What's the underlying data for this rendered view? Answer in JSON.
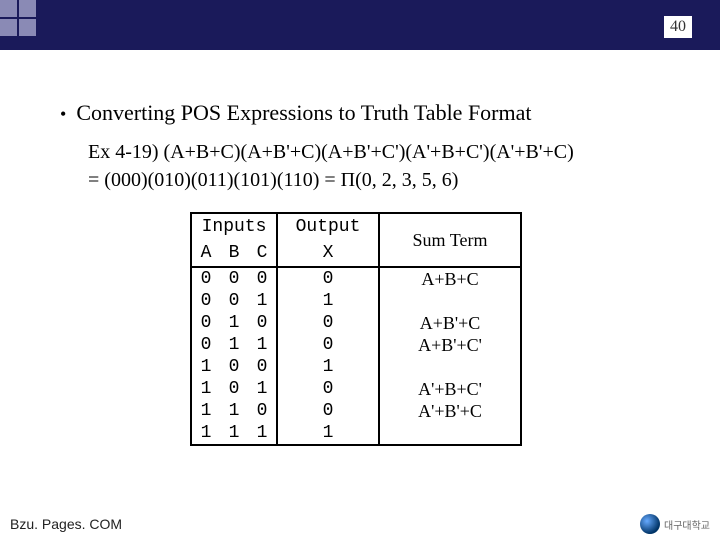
{
  "page_number": "40",
  "title": "Converting POS Expressions to Truth Table Format",
  "example_line1": "Ex 4-19) (A+B+C)(A+B'+C)(A+B'+C')(A'+B+C')(A'+B'+C)",
  "example_line2": "= (000)(010)(011)(101)(110) = Π(0, 2, 3, 5, 6)",
  "table": {
    "head_inputs": "Inputs",
    "head_A": "A",
    "head_B": "B",
    "head_C": "C",
    "head_output": "Output",
    "head_X": "X",
    "head_sum": "Sum Term",
    "rows": [
      {
        "a": "0",
        "b": "0",
        "c": "0",
        "x": "0",
        "term": "A+B+C"
      },
      {
        "a": "0",
        "b": "0",
        "c": "1",
        "x": "1",
        "term": ""
      },
      {
        "a": "0",
        "b": "1",
        "c": "0",
        "x": "0",
        "term": "A+B'+C"
      },
      {
        "a": "0",
        "b": "1",
        "c": "1",
        "x": "0",
        "term": "A+B'+C'"
      },
      {
        "a": "1",
        "b": "0",
        "c": "0",
        "x": "1",
        "term": ""
      },
      {
        "a": "1",
        "b": "0",
        "c": "1",
        "x": "0",
        "term": "A'+B+C'"
      },
      {
        "a": "1",
        "b": "1",
        "c": "0",
        "x": "0",
        "term": "A'+B'+C"
      },
      {
        "a": "1",
        "b": "1",
        "c": "1",
        "x": "1",
        "term": ""
      }
    ]
  },
  "footer": "Bzu. Pages. COM",
  "logo_text": "대구대학교"
}
